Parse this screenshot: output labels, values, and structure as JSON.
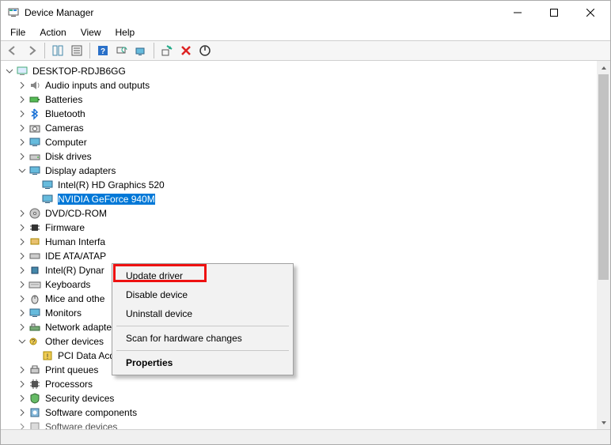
{
  "title": "Device Manager",
  "menus": {
    "file": "File",
    "action": "Action",
    "view": "View",
    "help": "Help"
  },
  "root": "DESKTOP-RDJB6GG",
  "categories": {
    "audio": "Audio inputs and outputs",
    "batteries": "Batteries",
    "bluetooth": "Bluetooth",
    "cameras": "Cameras",
    "computer": "Computer",
    "diskdrives": "Disk drives",
    "display": "Display adapters",
    "display_child1": "Intel(R) HD Graphics 520",
    "display_child2": "NVIDIA GeForce 940M",
    "dvd": "DVD/CD-ROM",
    "firmware": "Firmware",
    "hid": "Human Interfa",
    "ide": "IDE ATA/ATAP",
    "intelDyn": "Intel(R) Dynar",
    "keyboards": "Keyboards",
    "mice": "Mice and othe",
    "monitors": "Monitors",
    "network": "Network adapters",
    "otherdev": "Other devices",
    "otherdev_child": "PCI Data Acquisition and Signal Processing Controller",
    "printqueues": "Print queues",
    "processors": "Processors",
    "security": "Security devices",
    "swcomponents": "Software components",
    "swdevices": "Software devices"
  },
  "ctx": {
    "update": "Update driver",
    "disable": "Disable device",
    "uninstall": "Uninstall device",
    "scan": "Scan for hardware changes",
    "properties": "Properties"
  }
}
